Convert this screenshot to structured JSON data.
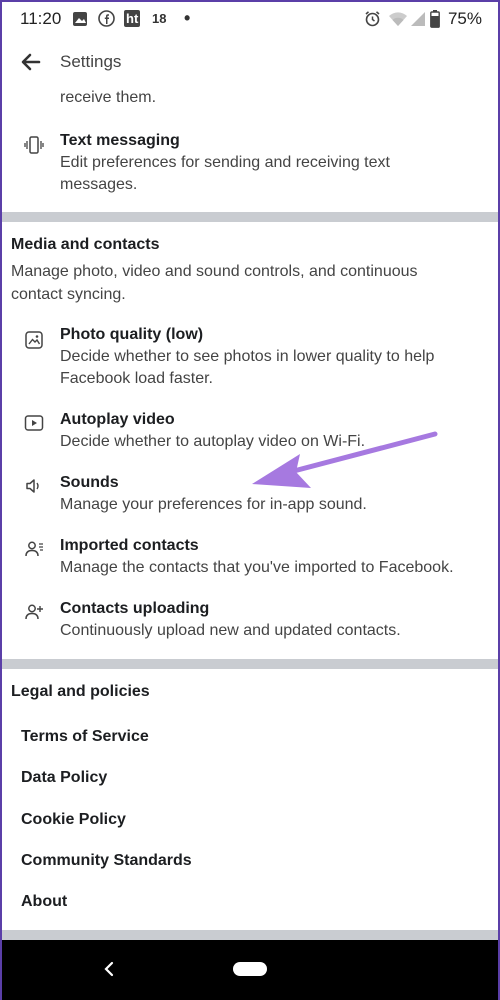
{
  "status_bar": {
    "time": "11:20",
    "badge_count": "18",
    "ht_label": "ht",
    "battery": "75%"
  },
  "app_bar": {
    "title": "Settings"
  },
  "top_section": {
    "clipped_text": "receive them.",
    "text_messaging": {
      "title": "Text messaging",
      "description": "Edit preferences for sending and receiving text messages."
    }
  },
  "media_section": {
    "title": "Media and contacts",
    "description": "Manage photo, video and sound controls, and continuous contact syncing.",
    "items": [
      {
        "title": "Photo quality (low)",
        "description": "Decide whether to see photos in lower quality to help Facebook load faster.",
        "icon": "photo-icon"
      },
      {
        "title": "Autoplay video",
        "description": "Decide whether to autoplay video on Wi-Fi.",
        "icon": "play-icon"
      },
      {
        "title": "Sounds",
        "description": "Manage your preferences for in-app sound.",
        "icon": "speaker-icon"
      },
      {
        "title": "Imported contacts",
        "description": "Manage the contacts that you've imported to Facebook.",
        "icon": "contacts-icon"
      },
      {
        "title": "Contacts uploading",
        "description": "Continuously upload new and updated contacts.",
        "icon": "add-contact-icon"
      }
    ]
  },
  "legal_section": {
    "title": "Legal and policies",
    "links": [
      "Terms of Service",
      "Data Policy",
      "Cookie Policy",
      "Community Standards",
      "About"
    ]
  },
  "colors": {
    "divider": "#c9ccd1",
    "annotation_arrow": "#a679e0",
    "nav_bar": "#000000"
  }
}
